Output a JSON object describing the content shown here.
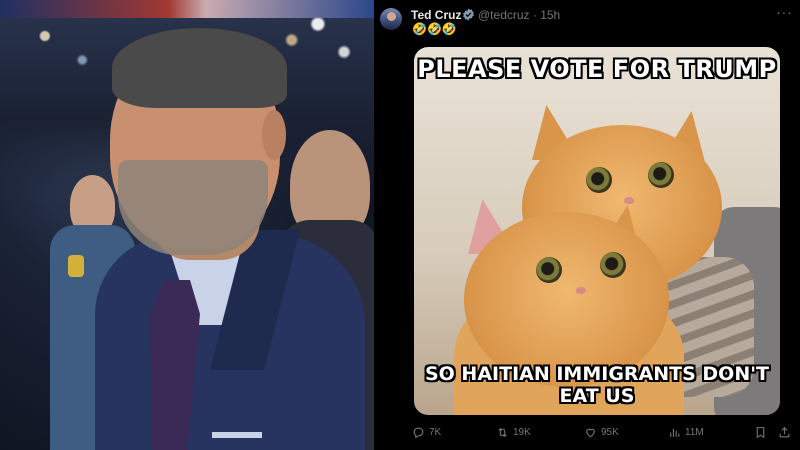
{
  "tweet": {
    "display_name": "Ted Cruz",
    "handle_time": "@tedcruz · 15h",
    "text": "🤣🤣🤣",
    "more_label": "···"
  },
  "meme": {
    "top_text": "PLEASE VOTE FOR TRUMP",
    "bottom_line1": "SO HAITIAN IMMIGRANTS DON'T",
    "bottom_line2": "EAT US"
  },
  "actions": {
    "replies": "7K",
    "reposts": "19K",
    "likes": "95K",
    "views": "11M"
  },
  "icons": {
    "reply": "reply-icon",
    "repost": "repost-icon",
    "like": "heart-icon",
    "views": "views-icon",
    "bookmark": "bookmark-icon",
    "share": "share-icon",
    "verified": "verified-badge-icon"
  },
  "colors": {
    "background": "#000000",
    "text_primary": "#e7e9ea",
    "text_secondary": "#71767b",
    "verified_badge": "#829aab"
  }
}
